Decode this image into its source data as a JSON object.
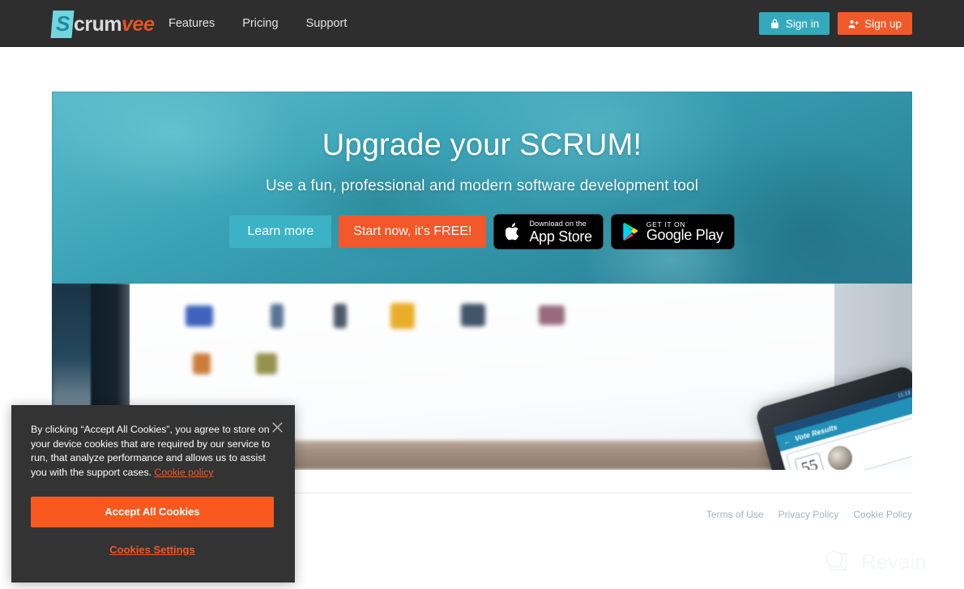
{
  "header": {
    "logo": {
      "badge_letter": "S",
      "part1": "crum",
      "part2": "vee"
    },
    "nav": [
      {
        "label": "Features",
        "name": "nav-features"
      },
      {
        "label": "Pricing",
        "name": "nav-pricing"
      },
      {
        "label": "Support",
        "name": "nav-support"
      }
    ],
    "signin_label": "Sign in",
    "signup_label": "Sign up",
    "signin_icon": "lock-icon",
    "signup_icon": "user-plus-icon",
    "colors": {
      "bar": "#2e2e2e",
      "signin": "#34a9bd",
      "signup": "#f05a2b"
    }
  },
  "hero": {
    "title": "Upgrade your SCRUM!",
    "subtitle": "Use a fun, professional and modern software development tool",
    "learn_more": "Learn more",
    "start_now": "Start now, it's FREE!",
    "appstore": {
      "small": "Download on the",
      "big": "App Store",
      "icon": "apple-icon"
    },
    "googleplay": {
      "small": "GET IT ON",
      "big": "Google Play",
      "icon": "google-play-icon"
    },
    "photo": {
      "phone_app_title": "Vote Results",
      "phone_time": "11:13",
      "phone_card_value": "55"
    },
    "colors": {
      "teal": "#3ba3b6",
      "learn": "#3bb3c4",
      "start": "#f3572a"
    }
  },
  "footer": {
    "links": [
      {
        "label": "Terms of Use",
        "name": "footer-link-terms-of-use"
      },
      {
        "label": "Privacy Policy",
        "name": "footer-link-privacy-policy"
      },
      {
        "label": "Cookie Policy",
        "name": "footer-link-cookie-policy"
      }
    ]
  },
  "watermark": {
    "label": "Revain",
    "icon": "revain-logo-icon"
  },
  "cookie_banner": {
    "text_before_link": "By clicking “Accept All Cookies”, you agree to store on your device cookies that are required by our service to run, that analyze performance and allows us to assist you with the support cases. ",
    "policy_link": "Cookie policy",
    "accept_label": "Accept All Cookies",
    "settings_label": "Cookies Settings",
    "close_icon": "close-icon",
    "colors": {
      "background": "#333333",
      "accept": "#f9591f",
      "link": "#f3572a"
    }
  }
}
